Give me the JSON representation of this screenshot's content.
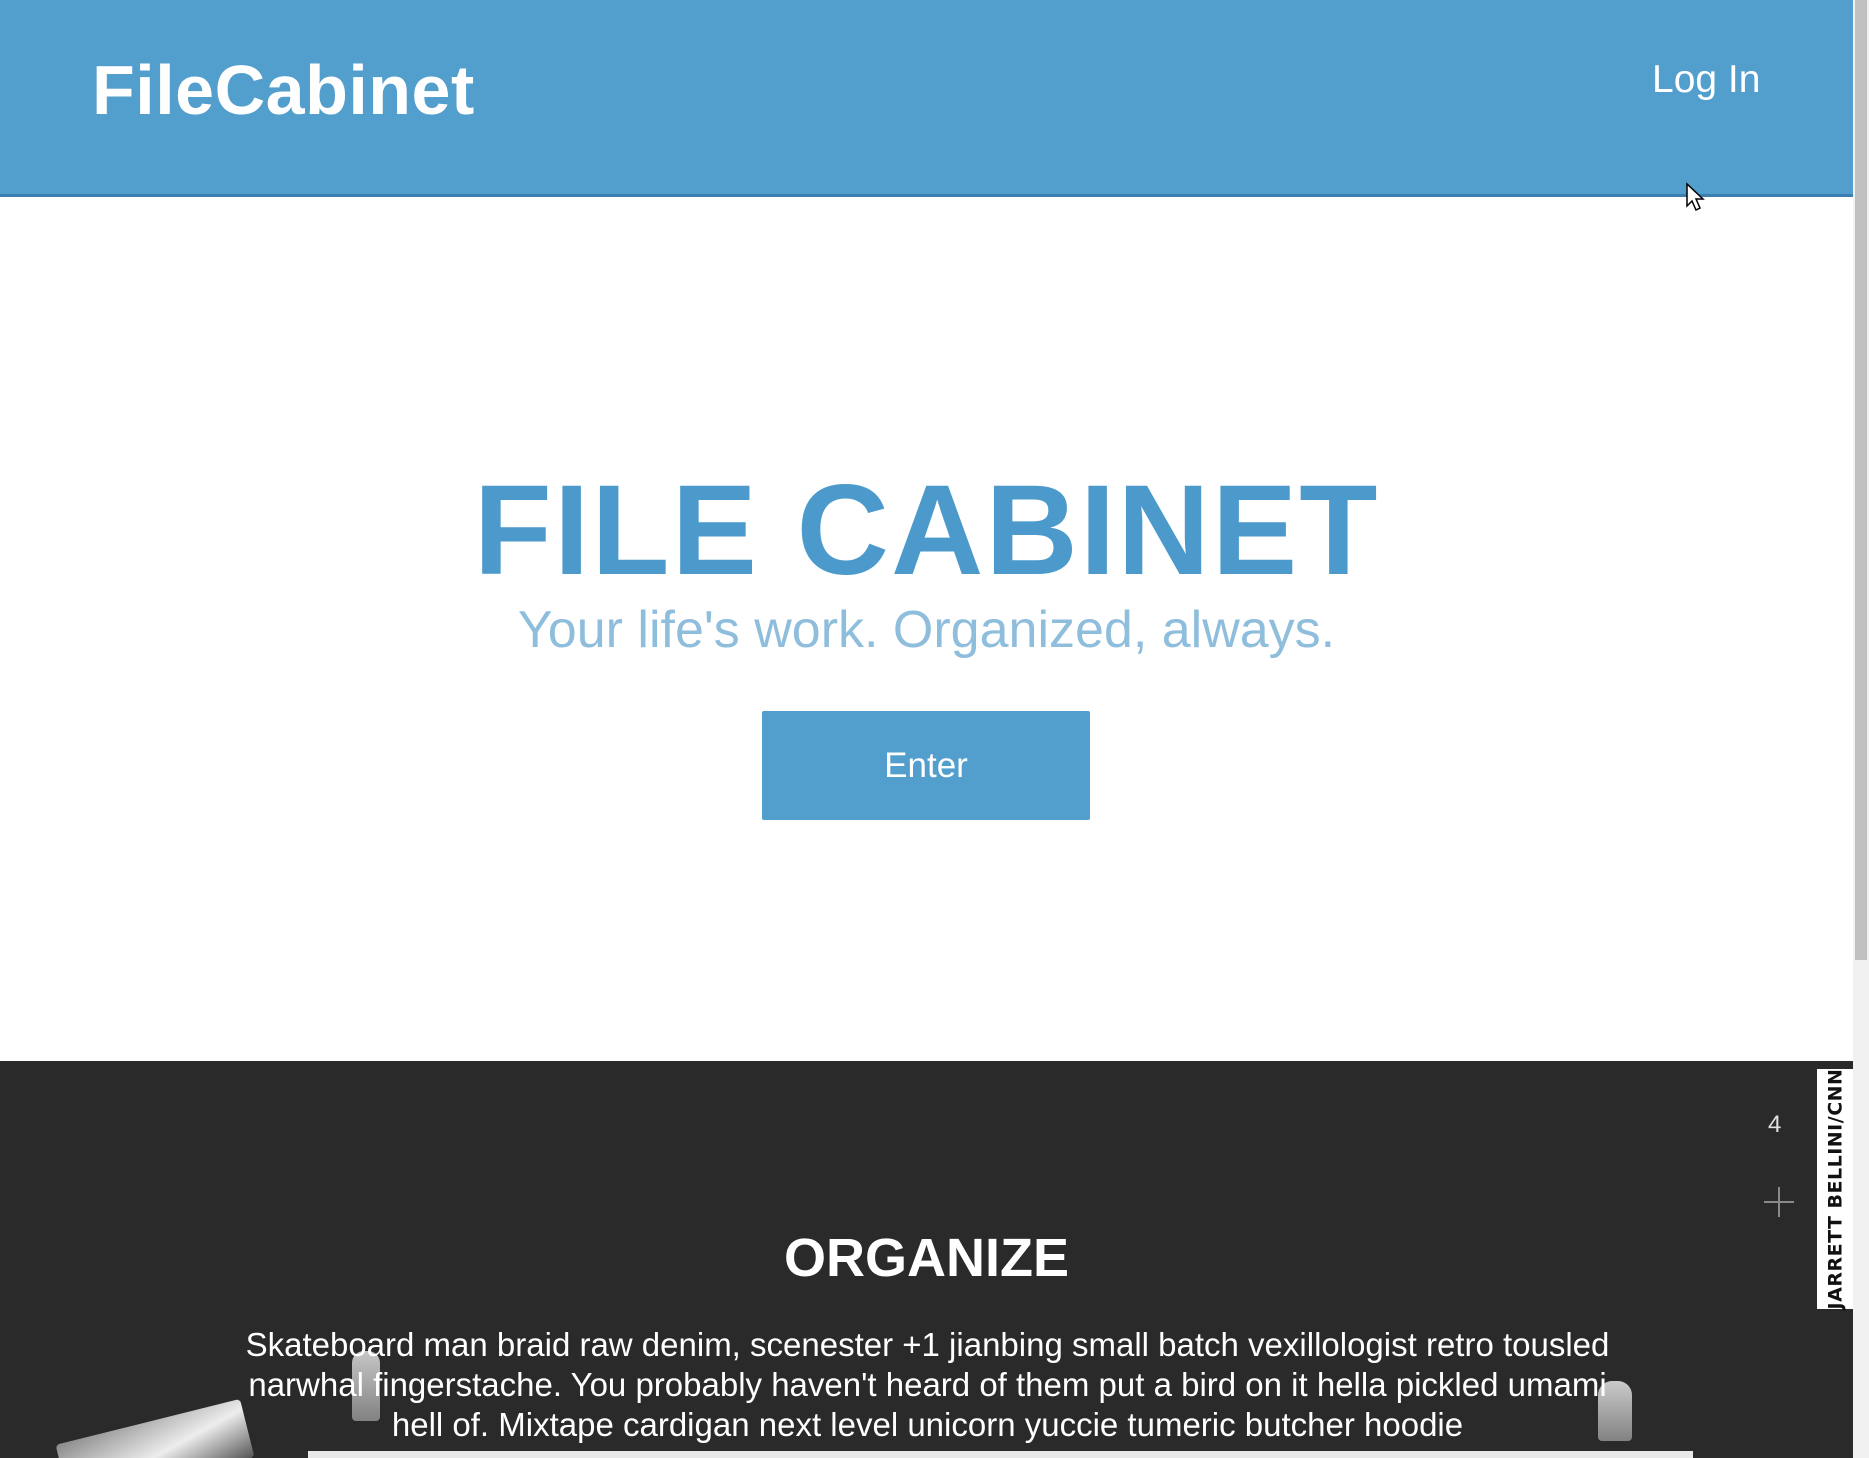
{
  "navbar": {
    "brand": "FileCabinet",
    "login_label": "Log In"
  },
  "hero": {
    "title": "FILE CABINET",
    "subtitle": "Your life's work. Organized, always.",
    "enter_label": "Enter"
  },
  "organize": {
    "title": "ORGANIZE",
    "text": "Skateboard man braid raw denim, scenester +1 jianbing small batch vexillologist retro tousled narwhal fingerstache. You probably haven't heard of them put a bird on it hella pickled umami hell of. Mixtape cardigan next level unicorn yuccie tumeric butcher hoodie",
    "slide_counter": "4",
    "photo_credit": "JARRETT BELLINI/CNN"
  },
  "icons": {
    "plus": "plus-icon",
    "cursor": "mouse-pointer-icon"
  },
  "colors": {
    "brand_blue": "#529fcd",
    "title_blue": "#4b9acb",
    "subtitle_blue": "#8fbedd",
    "dark_section": "#2a2a2a"
  }
}
